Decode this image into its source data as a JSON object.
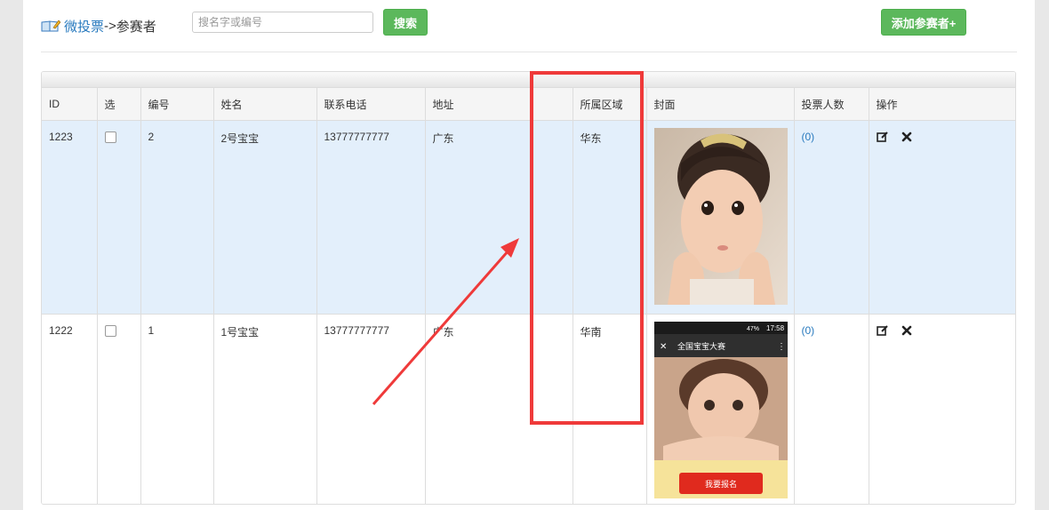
{
  "breadcrumb": {
    "link": "微投票",
    "sep": "->",
    "current": "参赛者"
  },
  "search": {
    "placeholder": "搜名字或编号",
    "value": "",
    "button": "搜索"
  },
  "add_button": "添加参赛者+",
  "table": {
    "headers": [
      "ID",
      "选",
      "编号",
      "姓名",
      "联系电话",
      "地址",
      "所属区域",
      "封面",
      "投票人数",
      "操作"
    ],
    "rows": [
      {
        "id": "1223",
        "number": "2",
        "name": "2号宝宝",
        "phone": "13777777777",
        "address": "广东",
        "region": "华东",
        "votes": "(0)"
      },
      {
        "id": "1222",
        "number": "1",
        "name": "1号宝宝",
        "phone": "13777777777",
        "address": "广东",
        "region": "华南",
        "votes": "(0)"
      }
    ]
  },
  "cover2": {
    "status_time": "17:58",
    "status_battery": "47%",
    "title": "全国宝宝大赛",
    "button": "我要报名"
  },
  "icons": {
    "breadcrumb": "book-icon",
    "edit": "edit-icon",
    "delete": "delete-icon"
  },
  "colors": {
    "accent_green": "#5cb85c",
    "link_blue": "#2a7bbf",
    "highlight_row": "#e3effb",
    "annotation_red": "#ef3a3a"
  }
}
